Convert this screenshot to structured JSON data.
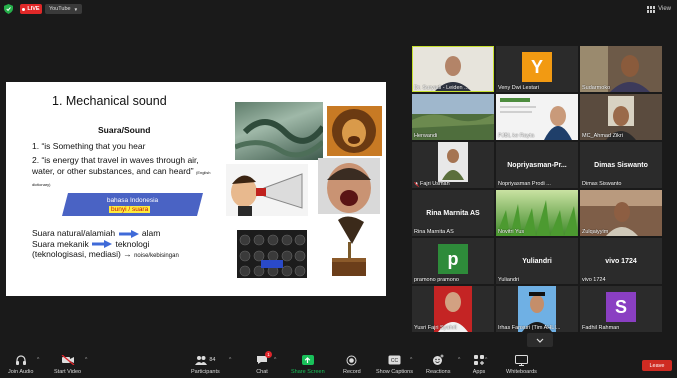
{
  "topbar": {
    "live_label": "LIVE",
    "stream_label": "YouTube",
    "view_label": "View"
  },
  "slide": {
    "title": "1. Mechanical sound",
    "subtitle": "Suara/Sound",
    "line1": "1. “is Something that you hear",
    "line2": "2. “is energy that travel in waves through air, water, or other substances, and can heard”",
    "line2_note": "(English dictionary)",
    "bahasa_label": "bahasa Indonesia",
    "bahasa_highlight": "bunyi / suara",
    "natural_text": "Suara natural/alamiah",
    "natural_target": "alam",
    "mekanik_text": "Suara mekanik",
    "mekanik_target": "teknologi",
    "tekno_text": "(teknologisasi, mediasi)",
    "noise_text": "noise/kebisingan"
  },
  "participants": [
    {
      "name": "Dr. Suryadi - Leiden ...",
      "type": "video",
      "active": true
    },
    {
      "name": "Veny Dwi Lestari",
      "type": "avatar",
      "initial": "Y",
      "color": "#f29a12"
    },
    {
      "name": "Sudarmoko",
      "type": "video"
    },
    {
      "name": "Herwandi",
      "type": "video"
    },
    {
      "name": "PJBL ke Rayta",
      "type": "video"
    },
    {
      "name": "MC_Ahmad Zikri",
      "type": "video"
    },
    {
      "name": "Fajri Usman",
      "type": "video"
    },
    {
      "name": "Nopriyasman Prodi ...",
      "type": "name",
      "center": "Nopriyasman-Pr..."
    },
    {
      "name": "Dimas Siswanto",
      "type": "name",
      "center": "Dimas Siswanto"
    },
    {
      "name": "Rina Marnita AS",
      "type": "name",
      "center": "Rina Marnita AS"
    },
    {
      "name": "Novitri Yus",
      "type": "video"
    },
    {
      "name": "Zulqaiyyim",
      "type": "video"
    },
    {
      "name": "pramono pramono",
      "type": "avatar",
      "initial": "p",
      "color": "#2e8b3a"
    },
    {
      "name": "Yuliandri",
      "type": "name",
      "center": "Yuliandri"
    },
    {
      "name": "vivo 1724",
      "type": "name",
      "center": "vivo 1724"
    },
    {
      "name": "Yusri Fajri Syahril",
      "type": "video"
    },
    {
      "name": "Irhas Fansuri (Tim AHLI...",
      "type": "video"
    },
    {
      "name": "Fadhil Rahman",
      "type": "avatar",
      "initial": "S",
      "color": "#8a3fc2"
    }
  ],
  "toolbar": {
    "join_audio": "Join Audio",
    "start_video": "Start Video",
    "participants": "Participants",
    "participant_count": "84",
    "chat": "Chat",
    "chat_count": "1",
    "share_screen": "Share Screen",
    "record": "Record",
    "show_captions": "Show Captions",
    "reactions": "Reactions",
    "apps": "Apps",
    "whiteboards": "Whiteboards",
    "leave": "Leave"
  },
  "colors": {
    "live": "#e02828",
    "share": "#19c15a",
    "leave": "#cf2b22",
    "active_speaker": "#c7e030",
    "bahasa_box": "#4a63c4"
  }
}
